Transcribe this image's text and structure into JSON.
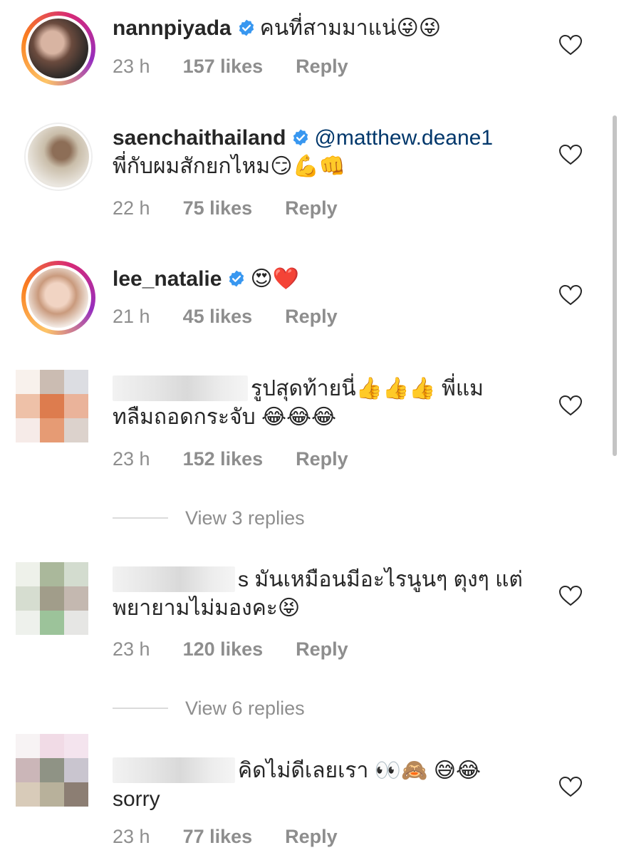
{
  "comments": [
    {
      "username": "nannpiyada",
      "verified": true,
      "text_line1": "คนที่สามมาแน่😜😜",
      "text_line2": "",
      "time": "23 h",
      "likes": "157 likes",
      "reply": "Reply"
    },
    {
      "username": "saenchaithailand",
      "verified": true,
      "mention": "@matthew.deane1",
      "text_line1": "",
      "text_line2": "พี่กับผมสักยกไหม😏💪👊",
      "time": "22 h",
      "likes": "75 likes",
      "reply": "Reply"
    },
    {
      "username": "lee_natalie",
      "verified": true,
      "text_line1": "😍❤️",
      "text_line2": "",
      "time": "21 h",
      "likes": "45 likes",
      "reply": "Reply"
    },
    {
      "username": "",
      "verified": false,
      "text_line1": "รูปสุดท้ายนี่👍👍👍 พี่แม",
      "text_line2": "ทลืมถอดกระจับ 😂😂😂",
      "time": "23 h",
      "likes": "152 likes",
      "reply": "Reply",
      "view_replies": "View 3 replies"
    },
    {
      "username": "",
      "verified": false,
      "text_line1": "s มันเหมือนมีอะไรนูนๆ ตุงๆ แต่",
      "text_line2": "พยายามไม่มองคะ😝",
      "time": "23 h",
      "likes": "120 likes",
      "reply": "Reply",
      "view_replies": "View 6 replies"
    },
    {
      "username": "",
      "verified": false,
      "text_line1": "คิดไม่ดีเลยเรา 👀🙈 😅😂",
      "text_line2": "sorry",
      "time": "23 h",
      "likes": "77 likes",
      "reply": "Reply"
    }
  ],
  "colors": {
    "text": "#262626",
    "secondary": "#8e8e8e",
    "mention": "#00376b",
    "verified_badge": "#3897f0",
    "ring_gradient": [
      "#fdc468",
      "#fa7e1e",
      "#d62976",
      "#962fbf"
    ]
  },
  "icons": {
    "like": "heart-outline-icon",
    "verified": "verified-badge-icon"
  }
}
